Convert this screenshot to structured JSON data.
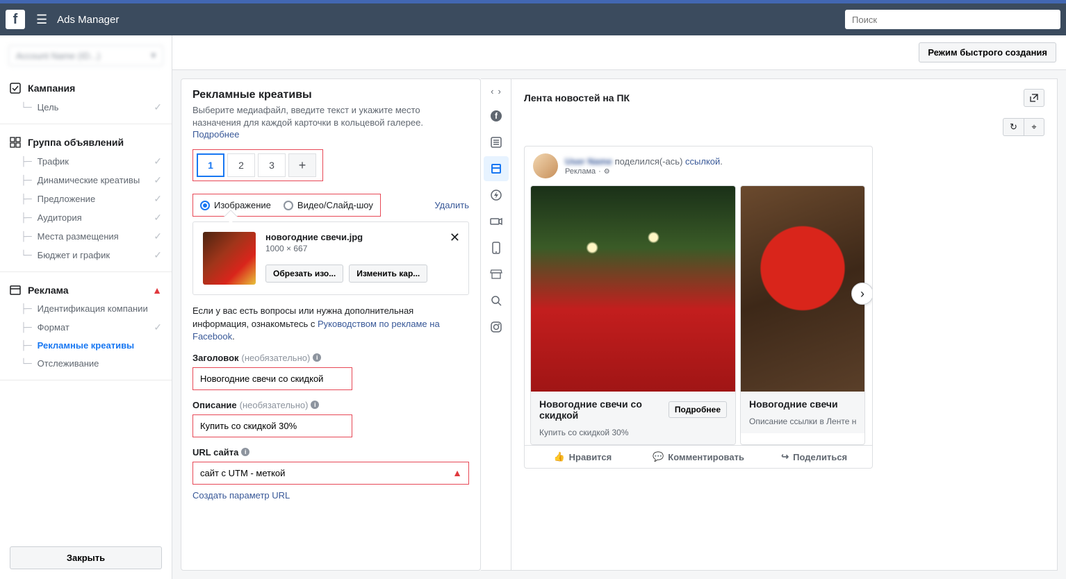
{
  "header": {
    "title": "Ads Manager",
    "search_placeholder": "Поиск"
  },
  "account": {
    "name": "Account Name (ID...)"
  },
  "nav": {
    "campaign": {
      "header": "Кампания",
      "goal": "Цель"
    },
    "adset": {
      "header": "Группа объявлений",
      "items": [
        "Трафик",
        "Динамические креативы",
        "Предложение",
        "Аудитория",
        "Места размещения",
        "Бюджет и график"
      ]
    },
    "ad": {
      "header": "Реклама",
      "items": [
        "Идентификация компании",
        "Формат",
        "Рекламные креативы",
        "Отслеживание"
      ]
    }
  },
  "footer": {
    "close": "Закрыть"
  },
  "toolbar": {
    "quick_create": "Режим быстрого создания"
  },
  "editor": {
    "title": "Рекламные креативы",
    "subtitle": "Выберите медиафайл, введите текст и укажите место назначения для каждой карточки в кольцевой галерее.",
    "learn_more": "Подробнее",
    "tabs": [
      "1",
      "2",
      "3"
    ],
    "media_type": {
      "image": "Изображение",
      "video": "Видео/Слайд-шоу"
    },
    "delete": "Удалить",
    "file": {
      "name": "новогодние свечи.jpg",
      "dimensions": "1000 × 667",
      "crop": "Обрезать изо...",
      "change": "Изменить кар..."
    },
    "help_pre": "Если у вас есть вопросы или нужна дополнительная информация, ознакомьтесь с ",
    "help_link": "Руководством по рекламе на Facebook",
    "help_post": ".",
    "headline": {
      "label": "Заголовок",
      "optional": "(необязательно)",
      "value": "Новогодние свечи со скидкой"
    },
    "description": {
      "label": "Описание",
      "optional": "(необязательно)",
      "value": "Купить со скидкой 30%"
    },
    "url": {
      "label": "URL сайта",
      "value": "сайт с UTM - меткой",
      "create": "Создать параметр URL"
    }
  },
  "preview": {
    "title": "Лента новостей на ПК",
    "post": {
      "user_name": "User Name",
      "shared_text": "поделился(-ась)",
      "link_text": "ссылкой",
      "sponsored": "Реклама"
    },
    "cards": [
      {
        "title": "Новогодние свечи со скидкой",
        "desc": "Купить со скидкой 30%",
        "cta": "Подробнее"
      },
      {
        "title": "Новогодние свечи",
        "desc": "Описание ссылки в Ленте ново"
      }
    ],
    "actions": {
      "like": "Нравится",
      "comment": "Комментировать",
      "share": "Поделиться"
    }
  }
}
